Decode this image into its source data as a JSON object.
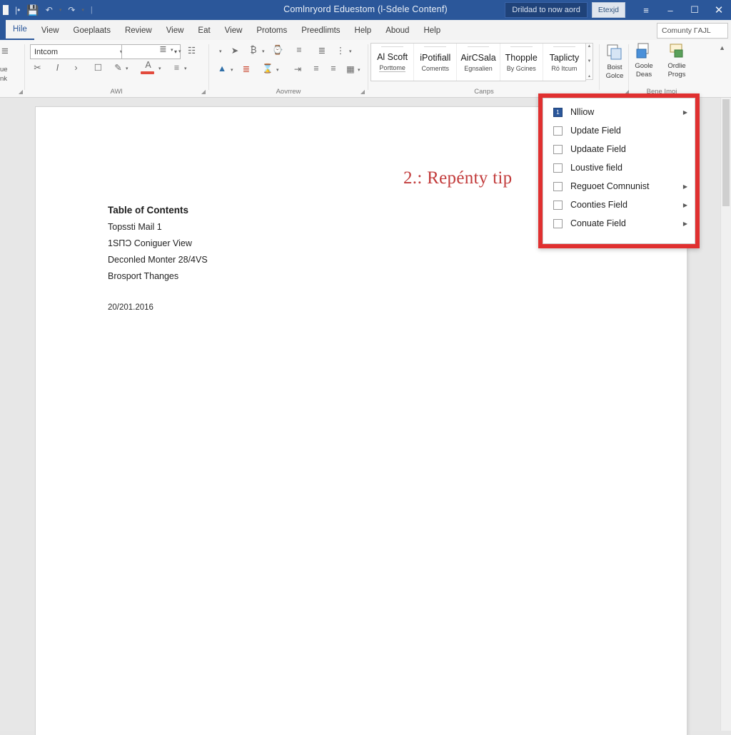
{
  "titlebar": {
    "quick_access": [
      "save-icon",
      "undo-icon",
      "redo-icon"
    ],
    "title": "Comlnryord Eduestom (l-Sdele Contenf)",
    "button_primary": "Drildad to now aord",
    "button_secondary": "Etexjd",
    "ribbon_display_icon": "ribbon-display-options-icon",
    "minimize": "–",
    "maximize": "❐",
    "close": "✕"
  },
  "tabs": [
    {
      "label": "Hile",
      "active": true
    },
    {
      "label": "View",
      "active": false
    },
    {
      "label": "Goeplaats",
      "active": false
    },
    {
      "label": "Review",
      "active": false
    },
    {
      "label": "View",
      "active": false
    },
    {
      "label": "Eat",
      "active": false
    },
    {
      "label": "View",
      "active": false
    },
    {
      "label": "Protoms",
      "active": false
    },
    {
      "label": "Preedlimts",
      "active": false
    },
    {
      "label": "Help",
      "active": false
    },
    {
      "label": "Aboud",
      "active": false
    },
    {
      "label": "Help",
      "active": false
    }
  ],
  "search": {
    "value": "Comunty ГAJL",
    "placeholder": "Comunty"
  },
  "ribbon": {
    "group_left": {
      "line1": "ue",
      "line2": "nk"
    },
    "font_group": {
      "label": "AWl",
      "font_name": "Intcom",
      "font_size": ""
    },
    "paragraph_group": {
      "label": "Aovrrew"
    },
    "styles_group": {
      "label": "Canps",
      "items": [
        {
          "title": "Al Scoft",
          "sub": "Porttome",
          "selected": true
        },
        {
          "title": "iPotifiall",
          "sub": "Comentts",
          "selected": false
        },
        {
          "title": "AirCSala",
          "sub": "Egnsalien",
          "selected": false
        },
        {
          "title": "Thopple",
          "sub": "By Gcines",
          "selected": false
        },
        {
          "title": "Taplicty",
          "sub": "Rö Itcum",
          "selected": false
        }
      ]
    },
    "right_group_a": {
      "button": {
        "line1": "Boist",
        "line2": "Golce"
      }
    },
    "right_group_b": {
      "label": "Bene Imoi",
      "buttons": [
        {
          "line1": "Goole",
          "line2": "Deas"
        },
        {
          "line1": "Ordlie",
          "line2": "Progs"
        }
      ]
    }
  },
  "menu": {
    "border_color": "#e03030",
    "items": [
      {
        "label": "Nlliow",
        "checked": true,
        "badge": "1",
        "submenu": true
      },
      {
        "label": "Update Field",
        "checked": false,
        "submenu": false
      },
      {
        "label": "Updaate Field",
        "checked": false,
        "submenu": false
      },
      {
        "label": "Loustive field",
        "checked": false,
        "submenu": false
      },
      {
        "label": "Reguoet Comnunist",
        "checked": false,
        "submenu": true
      },
      {
        "label": "Coonties Field",
        "checked": false,
        "submenu": true
      },
      {
        "label": "Conuate Field",
        "checked": false,
        "submenu": true
      }
    ]
  },
  "document": {
    "heading": "2.: Repénty tip",
    "heading_color": "#c23b3b",
    "toc_title": "Table of Contents",
    "toc_entries": [
      "Topssti Mail 1",
      "1SПƆ Coniguer View",
      "Deconled Monter 28/4VS",
      "Brosport Thanges"
    ],
    "date": "20/201.2016"
  }
}
